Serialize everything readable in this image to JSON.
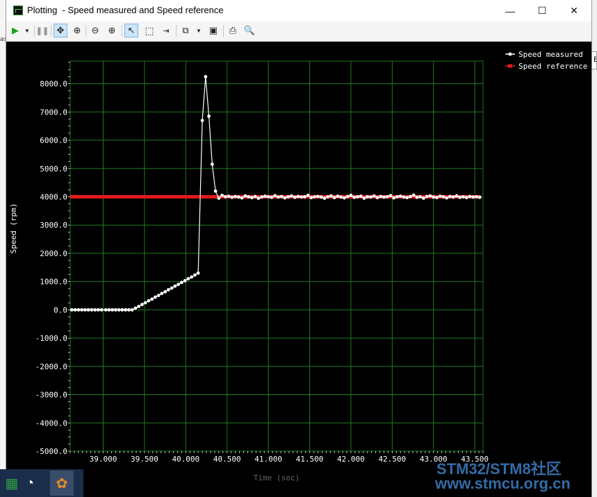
{
  "window": {
    "title": "Plotting  - Speed measured and Speed reference",
    "minimize": "—",
    "maximize": "☐",
    "close": "✕"
  },
  "toolbar": {
    "icons": [
      "play-icon",
      "dropdown-arrow-icon",
      "pause-icon",
      "pan-icon",
      "zoom-auto-icon",
      "zoom-out-icon",
      "zoom-in-icon",
      "select-pointer-icon",
      "select-box-icon",
      "split-icon",
      "copy-icon",
      "dropdown-arrow-icon",
      "save-icon",
      "print-icon",
      "print-preview-icon"
    ]
  },
  "taskbar": {
    "icons": [
      "excel-icon",
      "clock-icon",
      "app-icon"
    ]
  },
  "watermark": {
    "line1": "STM32/STM8社区",
    "line2": "www.stmcu.org.cn"
  },
  "colors": {
    "plot_bg": "#000000",
    "grid": "#1f7a1f",
    "measured": "#ffffff",
    "reference": "#e31a1a",
    "axis_text": "#ffffff"
  },
  "chart_data": {
    "type": "line",
    "title": "",
    "xlabel": "Time (sec)",
    "ylabel": "Speed (rpm)",
    "xlim": [
      38.6,
      43.6
    ],
    "ylim": [
      -5000,
      8800
    ],
    "x_ticks": [
      39.0,
      39.5,
      40.0,
      40.5,
      41.0,
      41.5,
      42.0,
      42.5,
      43.0,
      43.5
    ],
    "x_tick_labels": [
      "39.000",
      "39.500",
      "40.000",
      "40.500",
      "41.000",
      "41.500",
      "42.000",
      "42.500",
      "43.000",
      "43.500"
    ],
    "y_ticks": [
      8000,
      7000,
      6000,
      5000,
      4000,
      3000,
      2000,
      1000,
      0,
      -1000,
      -2000,
      -3000,
      -4000,
      -5000
    ],
    "y_tick_labels": [
      "8000.0",
      "7000.0",
      "6000.0",
      "5000.0",
      "4000.0",
      "3000.0",
      "2000.0",
      "1000.0",
      "0.0",
      "-1000.0",
      "-2000.0",
      "-3000.0",
      "-4000.0",
      "-5000.0"
    ],
    "grid": true,
    "legend_position": "top-right",
    "series": [
      {
        "name": "Speed measured",
        "color": "#ffffff",
        "points": [
          [
            38.62,
            0
          ],
          [
            38.66,
            0
          ],
          [
            38.7,
            0
          ],
          [
            38.74,
            0
          ],
          [
            38.78,
            0
          ],
          [
            38.82,
            0
          ],
          [
            38.86,
            0
          ],
          [
            38.9,
            0
          ],
          [
            38.94,
            0
          ],
          [
            38.98,
            0
          ],
          [
            39.03,
            0
          ],
          [
            39.07,
            0
          ],
          [
            39.11,
            0
          ],
          [
            39.15,
            0
          ],
          [
            39.19,
            0
          ],
          [
            39.23,
            0
          ],
          [
            39.27,
            0
          ],
          [
            39.31,
            0
          ],
          [
            39.35,
            0
          ],
          [
            39.39,
            60
          ],
          [
            39.43,
            120
          ],
          [
            39.47,
            190
          ],
          [
            39.51,
            250
          ],
          [
            39.55,
            320
          ],
          [
            39.59,
            380
          ],
          [
            39.63,
            450
          ],
          [
            39.67,
            510
          ],
          [
            39.71,
            580
          ],
          [
            39.75,
            640
          ],
          [
            39.79,
            710
          ],
          [
            39.83,
            770
          ],
          [
            39.87,
            840
          ],
          [
            39.91,
            900
          ],
          [
            39.95,
            970
          ],
          [
            39.99,
            1030
          ],
          [
            40.03,
            1100
          ],
          [
            40.07,
            1160
          ],
          [
            40.11,
            1230
          ],
          [
            40.15,
            1300
          ],
          [
            40.2,
            6700
          ],
          [
            40.24,
            8250
          ],
          [
            40.28,
            6850
          ],
          [
            40.32,
            5150
          ],
          [
            40.36,
            4200
          ],
          [
            40.4,
            3950
          ],
          [
            40.44,
            4050
          ],
          [
            40.48,
            4000
          ],
          [
            40.52,
            4020
          ],
          [
            40.56,
            3980
          ],
          [
            40.6,
            4010
          ],
          [
            40.64,
            3990
          ],
          [
            40.68,
            3960
          ],
          [
            40.72,
            4030
          ],
          [
            40.76,
            4000
          ],
          [
            40.8,
            3970
          ],
          [
            40.84,
            4010
          ],
          [
            40.88,
            3950
          ],
          [
            40.92,
            3990
          ],
          [
            40.96,
            4020
          ],
          [
            41.0,
            4000
          ],
          [
            41.04,
            3980
          ],
          [
            41.08,
            4040
          ],
          [
            41.12,
            3990
          ],
          [
            41.16,
            4010
          ],
          [
            41.2,
            3960
          ],
          [
            41.24,
            4000
          ],
          [
            41.28,
            4030
          ],
          [
            41.32,
            3980
          ],
          [
            41.36,
            4010
          ],
          [
            41.4,
            3990
          ],
          [
            41.44,
            4000
          ],
          [
            41.48,
            4050
          ],
          [
            41.52,
            3970
          ],
          [
            41.56,
            4000
          ],
          [
            41.6,
            4010
          ],
          [
            41.64,
            3990
          ],
          [
            41.68,
            3950
          ],
          [
            41.72,
            4000
          ],
          [
            41.76,
            4030
          ],
          [
            41.8,
            3970
          ],
          [
            41.84,
            4020
          ],
          [
            41.88,
            3990
          ],
          [
            41.92,
            3960
          ],
          [
            41.96,
            4010
          ],
          [
            42.0,
            4050
          ],
          [
            42.04,
            3980
          ],
          [
            42.08,
            4000
          ],
          [
            42.12,
            4020
          ],
          [
            42.16,
            3950
          ],
          [
            42.2,
            4000
          ],
          [
            42.24,
            3990
          ],
          [
            42.28,
            4030
          ],
          [
            42.32,
            3970
          ],
          [
            42.36,
            4010
          ],
          [
            42.4,
            3990
          ],
          [
            42.44,
            4000
          ],
          [
            42.48,
            4040
          ],
          [
            42.52,
            3960
          ],
          [
            42.56,
            4000
          ],
          [
            42.6,
            4020
          ],
          [
            42.64,
            3990
          ],
          [
            42.68,
            3970
          ],
          [
            42.72,
            4010
          ],
          [
            42.76,
            4060
          ],
          [
            42.8,
            3980
          ],
          [
            42.84,
            4000
          ],
          [
            42.88,
            3950
          ],
          [
            42.92,
            4010
          ],
          [
            42.96,
            4030
          ],
          [
            43.0,
            3990
          ],
          [
            43.04,
            3970
          ],
          [
            43.08,
            4020
          ],
          [
            43.12,
            4000
          ],
          [
            43.16,
            3960
          ],
          [
            43.2,
            4010
          ],
          [
            43.24,
            3990
          ],
          [
            43.28,
            4030
          ],
          [
            43.32,
            3980
          ],
          [
            43.36,
            4000
          ],
          [
            43.4,
            3970
          ],
          [
            43.44,
            4010
          ],
          [
            43.48,
            3990
          ],
          [
            43.52,
            4000
          ],
          [
            43.56,
            3980
          ]
        ]
      },
      {
        "name": "Speed reference",
        "color": "#e31a1a",
        "points_every": 0.035,
        "x_range": [
          38.62,
          43.56
        ],
        "value": 4000
      }
    ]
  }
}
